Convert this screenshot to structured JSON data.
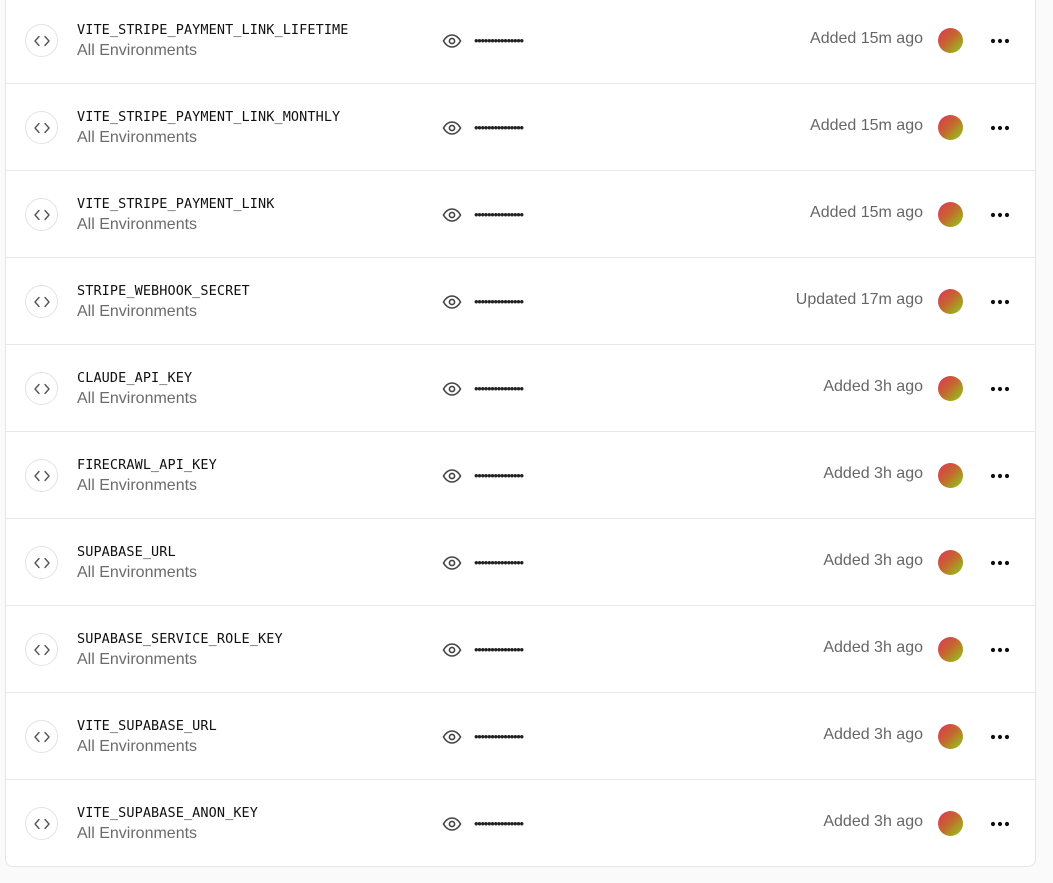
{
  "env_vars": [
    {
      "name": "VITE_STRIPE_PAYMENT_LINK_LIFETIME",
      "environment": "All Environments",
      "masked_value": "•••••••••••••••",
      "status": "Added 15m ago"
    },
    {
      "name": "VITE_STRIPE_PAYMENT_LINK_MONTHLY",
      "environment": "All Environments",
      "masked_value": "•••••••••••••••",
      "status": "Added 15m ago"
    },
    {
      "name": "VITE_STRIPE_PAYMENT_LINK",
      "environment": "All Environments",
      "masked_value": "•••••••••••••••",
      "status": "Added 15m ago"
    },
    {
      "name": "STRIPE_WEBHOOK_SECRET",
      "environment": "All Environments",
      "masked_value": "•••••••••••••••",
      "status": "Updated 17m ago"
    },
    {
      "name": "CLAUDE_API_KEY",
      "environment": "All Environments",
      "masked_value": "•••••••••••••••",
      "status": "Added 3h ago"
    },
    {
      "name": "FIRECRAWL_API_KEY",
      "environment": "All Environments",
      "masked_value": "•••••••••••••••",
      "status": "Added 3h ago"
    },
    {
      "name": "SUPABASE_URL",
      "environment": "All Environments",
      "masked_value": "•••••••••••••••",
      "status": "Added 3h ago"
    },
    {
      "name": "SUPABASE_SERVICE_ROLE_KEY",
      "environment": "All Environments",
      "masked_value": "•••••••••••••••",
      "status": "Added 3h ago"
    },
    {
      "name": "VITE_SUPABASE_URL",
      "environment": "All Environments",
      "masked_value": "•••••••••••••••",
      "status": "Added 3h ago"
    },
    {
      "name": "VITE_SUPABASE_ANON_KEY",
      "environment": "All Environments",
      "masked_value": "•••••••••••••••",
      "status": "Added 3h ago"
    }
  ],
  "icons": {
    "type": "code-brackets-icon",
    "reveal": "eye-icon",
    "avatar": "user-avatar",
    "menu": "more-horizontal-icon"
  },
  "colors": {
    "avatar_gradient": [
      "#e0335c",
      "#8bd018"
    ]
  }
}
